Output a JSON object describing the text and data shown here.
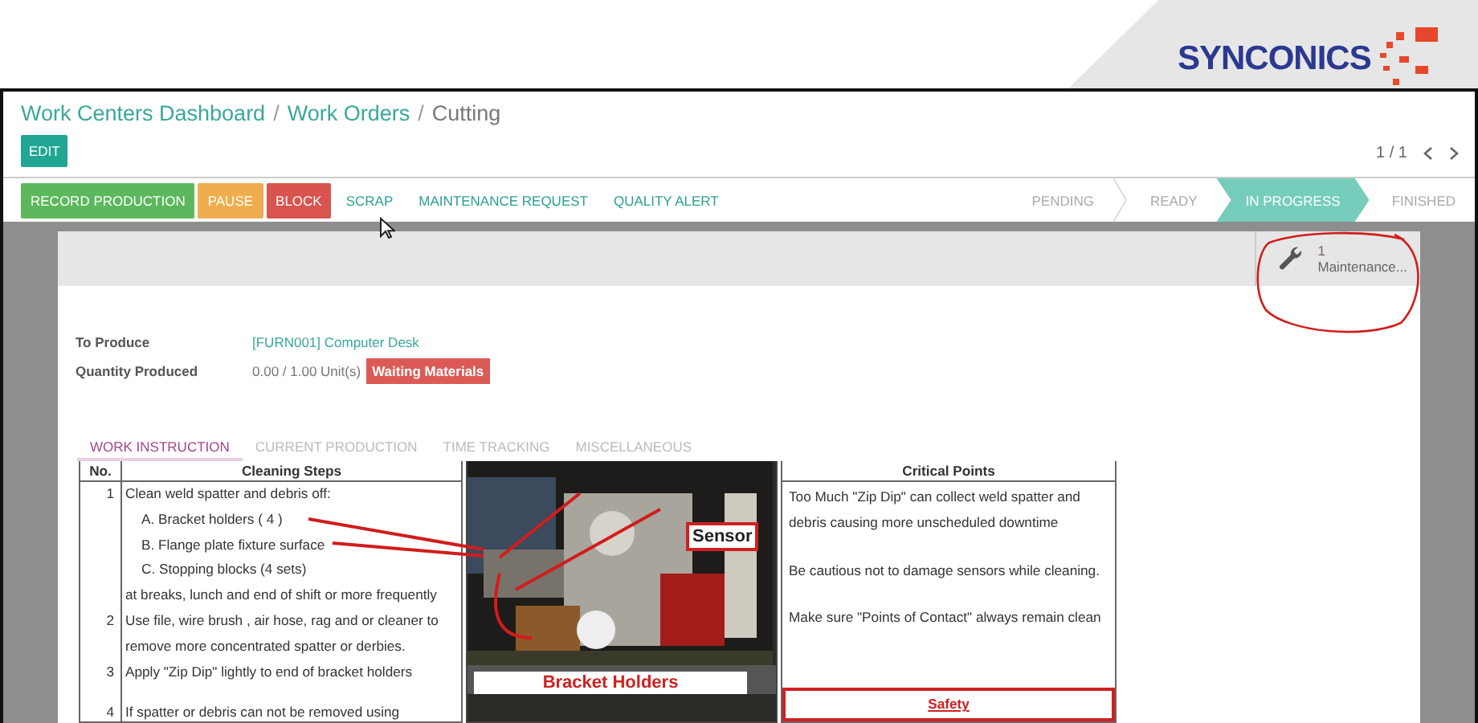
{
  "brand": {
    "name": "SYNCONICS"
  },
  "breadcrumb": {
    "separator": "/",
    "items": [
      {
        "label": "Work Centers Dashboard",
        "kind": "link"
      },
      {
        "label": "Work Orders",
        "kind": "link"
      },
      {
        "label": "Cutting",
        "kind": "current"
      }
    ]
  },
  "edit_button": "EDIT",
  "pager": "1 / 1",
  "actions": [
    {
      "label": "RECORD PRODUCTION",
      "kind": "success"
    },
    {
      "label": "PAUSE",
      "kind": "warning"
    },
    {
      "label": "BLOCK",
      "kind": "danger"
    },
    {
      "label": "SCRAP",
      "kind": "link"
    },
    {
      "label": "MAINTENANCE REQUEST",
      "kind": "link"
    },
    {
      "label": "QUALITY ALERT",
      "kind": "link"
    }
  ],
  "stages": [
    {
      "label": "PENDING",
      "selected": false
    },
    {
      "label": "READY",
      "selected": false
    },
    {
      "label": "IN PROGRESS",
      "selected": true
    },
    {
      "label": "FINISHED",
      "selected": false
    }
  ],
  "smart_button": {
    "count": "1",
    "label": "Maintenance..."
  },
  "fields": [
    {
      "label": "To Produce",
      "value": "[FURN001] Computer Desk",
      "kind": "link"
    },
    {
      "label": "Quantity Produced",
      "value": "0.00 / 1.00 Unit(s)",
      "kind": "text",
      "badge": "Waiting Materials"
    }
  ],
  "tabs": [
    {
      "label": "WORK INSTRUCTION",
      "selected": true
    },
    {
      "label": "CURRENT PRODUCTION",
      "selected": false
    },
    {
      "label": "TIME TRACKING",
      "selected": false
    },
    {
      "label": "MISCELLANEOUS",
      "selected": false
    }
  ],
  "instruction": {
    "no_header": "No.",
    "steps_header": "Cleaning Steps",
    "critical_header": "Critical Points",
    "steps": [
      {
        "no": "1",
        "lines": [
          {
            "text": "Clean weld spatter and debris off:",
            "kind": "main"
          },
          {
            "text": "A. Bracket holders ( 4 )",
            "kind": "sub"
          },
          {
            "text": "B. Flange plate fixture surface",
            "kind": "sub"
          },
          {
            "text": "C. Stopping blocks (4 sets)",
            "kind": "sub"
          },
          {
            "text": "at breaks, lunch and end of shift or more frequently",
            "kind": "main"
          }
        ]
      },
      {
        "no": "2",
        "lines": [
          {
            "text": "Use file, wire brush , air hose, rag and or cleaner to",
            "kind": "main"
          },
          {
            "text": "remove more concentrated spatter or derbies.",
            "kind": "main"
          }
        ]
      },
      {
        "no": "3",
        "lines": [
          {
            "text": "Apply \"Zip Dip\" lightly to end of bracket holders",
            "kind": "main"
          }
        ]
      },
      {
        "no": "4",
        "lines": [
          {
            "text": "If spatter or debris can not be removed using",
            "kind": "main"
          }
        ]
      }
    ],
    "sensor_label": "Sensor",
    "caption": "Bracket Holders",
    "critical_points": [
      "Too Much \"Zip Dip\" can collect weld spatter and debris causing more unscheduled downtime",
      "Be cautious not to damage sensors while cleaning.",
      "Make sure \"Points of Contact\" always remain clean"
    ],
    "safety_title": "Safety"
  }
}
